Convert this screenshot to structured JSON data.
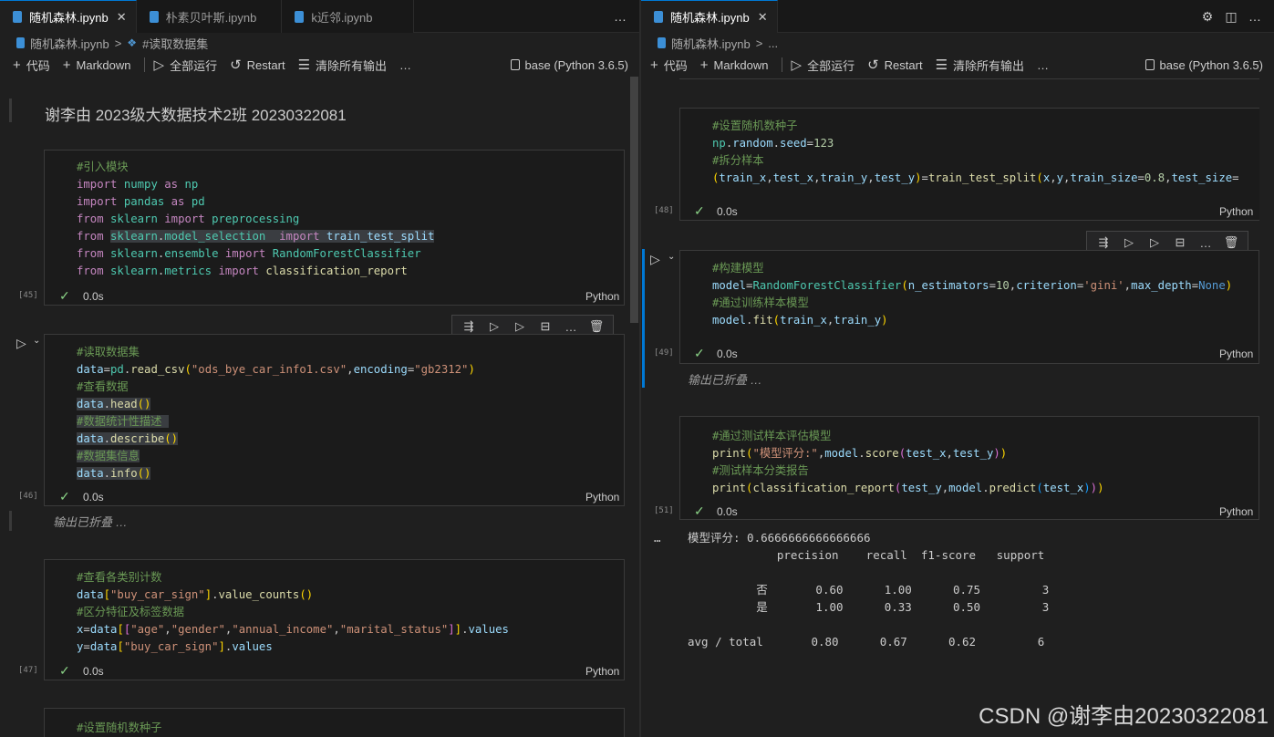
{
  "left": {
    "tabs": [
      {
        "label": "随机森林.ipynb",
        "active": true,
        "closable": true
      },
      {
        "label": "朴素贝叶斯.ipynb",
        "active": false
      },
      {
        "label": "k近邻.ipynb",
        "active": false
      }
    ],
    "more_icon": "…",
    "breadcrumb": {
      "file": "随机森林.ipynb",
      "sep": ">",
      "section": "#读取数据集"
    },
    "toolbar": {
      "add_code": "代码",
      "add_markdown": "Markdown",
      "run_all": "全部运行",
      "restart": "Restart",
      "clear": "清除所有输出",
      "more": "…",
      "kernel": "base (Python 3.6.5)"
    },
    "markdown_heading": "谢李由 2023级大数据技术2班 20230322081",
    "cells": [
      {
        "exec": "[45]",
        "status": "0.0s",
        "lang": "Python"
      },
      {
        "exec": "[46]",
        "status": "0.0s",
        "lang": "Python",
        "collapsed": "输出已折叠 …"
      },
      {
        "exec": "[47]",
        "status": "0.0s",
        "lang": "Python"
      },
      {
        "partial_comment": "#设置随机数种子"
      }
    ]
  },
  "right": {
    "tabs": [
      {
        "label": "随机森林.ipynb",
        "active": true,
        "closable": true
      }
    ],
    "breadcrumb": {
      "file": "随机森林.ipynb",
      "sep": ">",
      "section": "..."
    },
    "toolbar": {
      "add_code": "代码",
      "add_markdown": "Markdown",
      "run_all": "全部运行",
      "restart": "Restart",
      "clear": "清除所有输出",
      "more": "…",
      "kernel": "base (Python 3.6.5)"
    },
    "cells": [
      {
        "exec": "[48]",
        "status": "0.0s",
        "lang": "Python"
      },
      {
        "exec": "[49]",
        "status": "0.0s",
        "lang": "Python",
        "collapsed": "输出已折叠 …"
      },
      {
        "exec": "[51]",
        "status": "0.0s",
        "lang": "Python"
      }
    ],
    "output": {
      "ellipsis": "…",
      "lines": [
        "模型评分: 0.6666666666666666",
        "             precision    recall  f1-score   support",
        "",
        "          否       0.60      1.00      0.75         3",
        "          是       1.00      0.33      0.50         3",
        "",
        "avg / total       0.80      0.67      0.62         6"
      ]
    }
  },
  "watermark": "CSDN @谢李由20230322081",
  "icons": {
    "file": "notebook-file-icon",
    "close": "close-icon",
    "settings": "gear-icon",
    "split": "split-editor-icon",
    "run": "run-cell-icon",
    "check": "check-icon"
  },
  "colors": {
    "accent": "#0078d4",
    "success": "#89d185",
    "comment": "#6a9955",
    "keyword": "#c586c0",
    "string": "#ce9178"
  }
}
